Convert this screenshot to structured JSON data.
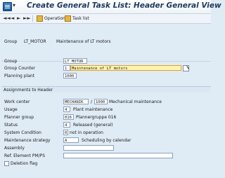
{
  "window": {
    "title": "Create General Task List: Header General View"
  },
  "toolbar": {
    "operation_label": "Operation",
    "tasklist_label": "Task list",
    "nav": [
      "◄◄",
      "◄",
      "►",
      "►►"
    ]
  },
  "header": {
    "group_label": "Group",
    "group_value": "LT_MOTOR",
    "group_desc": "Maintenance of LT motors"
  },
  "fields": {
    "group_label": "Group",
    "group_value": "LT_MOTOR",
    "counter_label": "Group Counter",
    "counter_value": "1",
    "counter_text": "Maintenance of LT motors",
    "plant_label": "Planning plant",
    "plant_value": "1000"
  },
  "assign": {
    "section_title": "Assignments to Header",
    "work_center_label": "Work center",
    "work_center_value": "MECHANIK",
    "work_center_sep": "/",
    "work_center_plant": "1000",
    "work_center_desc": "Mechanical maintenance",
    "usage_label": "Usage",
    "usage_value": "4",
    "usage_desc": "Plant maintenance",
    "planner_label": "Planner group",
    "planner_value": "016",
    "planner_desc": "Plannergruppe 016",
    "status_label": "Status",
    "status_value": "4",
    "status_desc": "Released (general)",
    "syscond_label": "System Condition",
    "syscond_value": "0",
    "syscond_desc": "not in operation",
    "strategy_label": "Maintenance strategy",
    "strategy_value": "A",
    "strategy_desc": "Scheduling by calendar",
    "assembly_label": "Assembly",
    "assembly_value": "",
    "ref_label": "Ref. Element PM/PS",
    "ref_value": "",
    "deletion_label": "Deletion flag"
  }
}
